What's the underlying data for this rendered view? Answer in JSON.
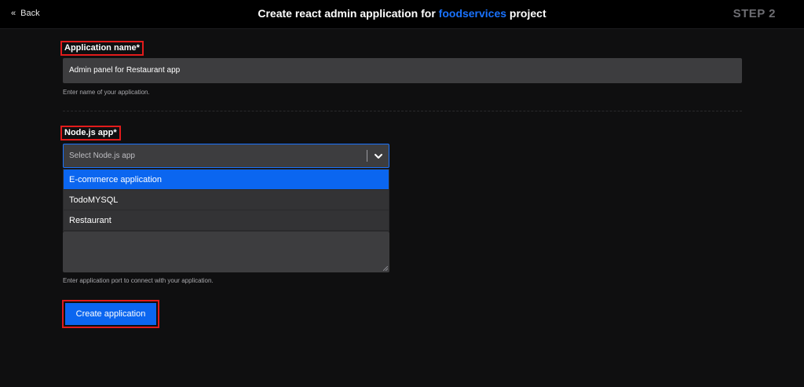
{
  "header": {
    "back_label": "Back",
    "title_prefix": "Create react admin application for ",
    "title_accent": "foodservices",
    "title_suffix": " project",
    "step": "STEP 2"
  },
  "form": {
    "app_name": {
      "label": "Application name*",
      "value": "Admin panel for Restaurant app",
      "help": "Enter name of your application."
    },
    "node_app": {
      "label": "Node.js app*",
      "placeholder": "Select Node.js app",
      "options": [
        "E-commerce application",
        "TodoMYSQL",
        "Restaurant"
      ],
      "highlighted_index": 0
    },
    "port_help": "Enter application port to connect with your application.",
    "submit_label": "Create application"
  },
  "colors": {
    "accent": "#1a73ff",
    "button": "#0b66f0",
    "highlight_border": "#e21b1b",
    "background": "#0f0f10"
  }
}
